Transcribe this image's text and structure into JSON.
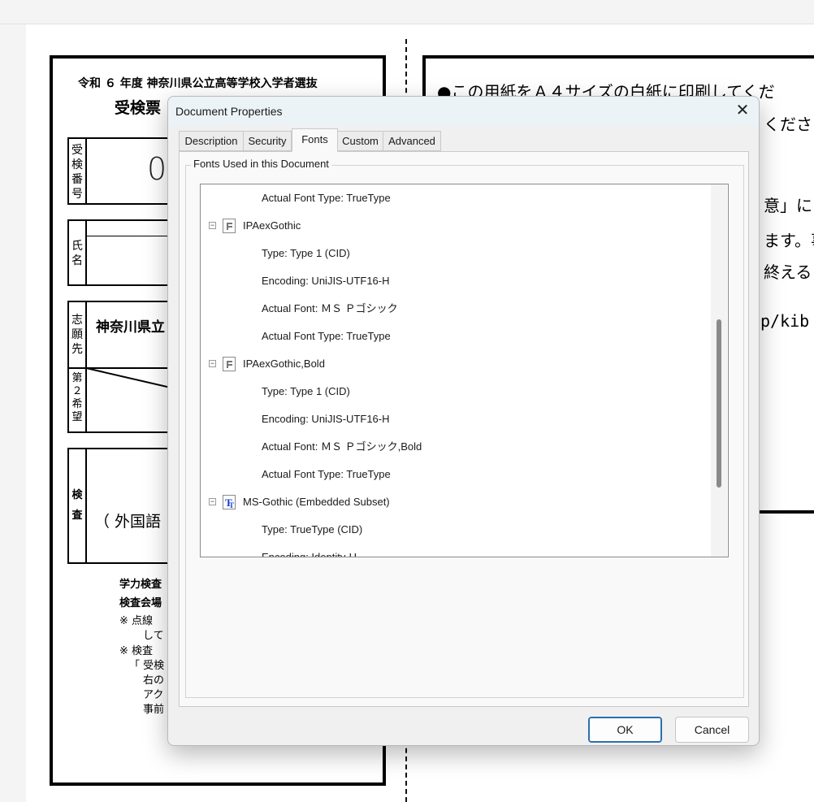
{
  "background_doc": {
    "header_line": "令和 ６ 年度 神奈川県公立高等学校入学者選抜",
    "title_fragment": "受検票",
    "exam_number_label": "受検番号",
    "exam_number_digit": "0",
    "name_label": "氏名",
    "choice_label": "志願先",
    "choice_value": "神奈川県立",
    "second_choice_label": "第２希望",
    "exam_label": "検査",
    "exam_subject": "（ 外国語",
    "notes": [
      "学力検査",
      "検査会場",
      "※ 点線",
      "して",
      "※ 検査",
      "「 受検",
      "右の",
      "アク",
      "事前"
    ],
    "right_lines": [
      "●この用紙をＡ４サイズの白紙に印刷してくだ",
      "くださ",
      "意」に",
      "ます。事",
      "終える",
      "p/kib"
    ]
  },
  "dialog": {
    "title": "Document Properties",
    "close_symbol": "✕",
    "tabs": [
      {
        "label": "Description",
        "active": false
      },
      {
        "label": "Security",
        "active": false
      },
      {
        "label": "Fonts",
        "active": true
      },
      {
        "label": "Custom",
        "active": false
      },
      {
        "label": "Advanced",
        "active": false
      }
    ],
    "group_label": "Fonts Used in this Document",
    "font_list": [
      {
        "kind": "detail",
        "text": "Actual Font Type: TrueType"
      },
      {
        "kind": "font",
        "icon": "type1-font-icon",
        "text": "IPAexGothic"
      },
      {
        "kind": "detail",
        "text": "Type: Type 1 (CID)"
      },
      {
        "kind": "detail",
        "text": "Encoding: UniJIS-UTF16-H"
      },
      {
        "kind": "detail",
        "text": "Actual Font: ＭＳ Ｐゴシック"
      },
      {
        "kind": "detail",
        "text": "Actual Font Type: TrueType"
      },
      {
        "kind": "font",
        "icon": "type1-font-icon",
        "text": "IPAexGothic,Bold"
      },
      {
        "kind": "detail",
        "text": "Type: Type 1 (CID)"
      },
      {
        "kind": "detail",
        "text": "Encoding: UniJIS-UTF16-H"
      },
      {
        "kind": "detail",
        "text": "Actual Font: ＭＳ Ｐゴシック,Bold"
      },
      {
        "kind": "detail",
        "text": "Actual Font Type: TrueType"
      },
      {
        "kind": "font",
        "icon": "truetype-font-icon",
        "text": "MS-Gothic (Embedded Subset)"
      },
      {
        "kind": "detail",
        "text": "Type: TrueType (CID)"
      },
      {
        "kind": "detail",
        "text": "Encoding: Identity-H"
      }
    ],
    "expander_symbol": "−",
    "ok_label": "OK",
    "cancel_label": "Cancel"
  },
  "colors": {
    "accent": "#2a6fb0",
    "titlebar": "#ecf3f7",
    "dialog_bg": "#f0f0f0"
  }
}
